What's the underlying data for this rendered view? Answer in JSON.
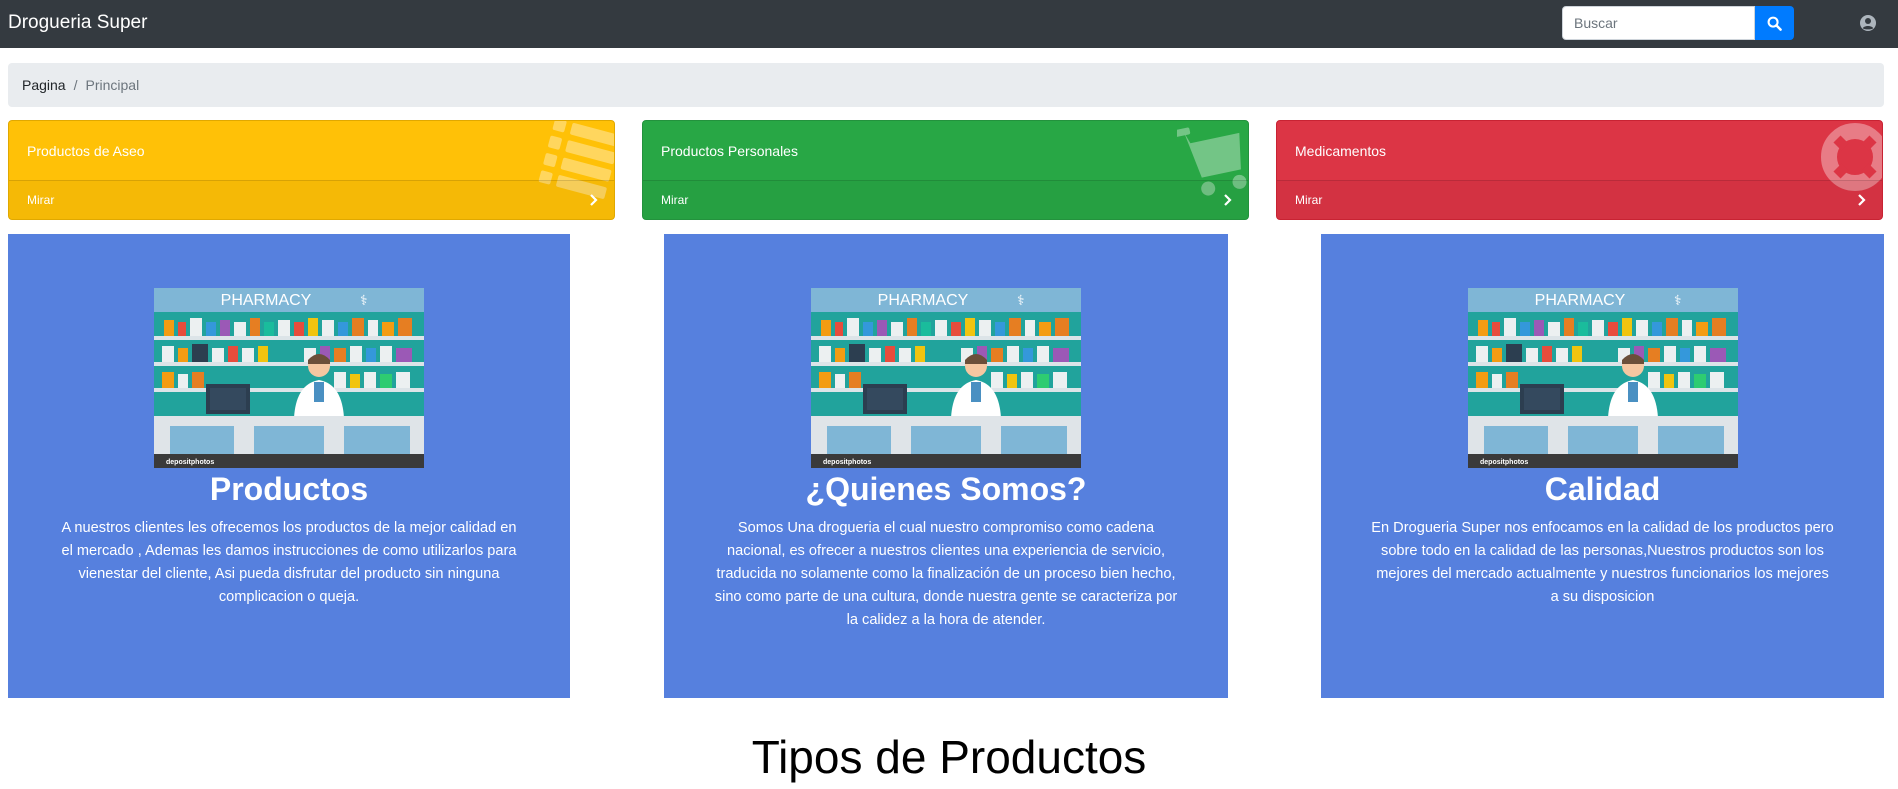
{
  "navbar": {
    "brand": "Drogueria Super",
    "search_placeholder": "Buscar",
    "search_icon": "search-icon",
    "user_icon": "user-circle-icon"
  },
  "breadcrumb": {
    "items": [
      "Pagina",
      "Principal"
    ],
    "separator": "/"
  },
  "categories": [
    {
      "title": "Productos de Aseo",
      "link": "Mirar",
      "color": "#ffc107",
      "icon": "list-icon"
    },
    {
      "title": "Productos Personales",
      "link": "Mirar",
      "color": "#28a745",
      "icon": "cart-icon"
    },
    {
      "title": "Medicamentos",
      "link": "Mirar",
      "color": "#dc3545",
      "icon": "life-ring-icon"
    }
  ],
  "panels": [
    {
      "title": "Productos",
      "text": "A nuestros clientes les ofrecemos los productos de la mejor calidad en el mercado , Ademas les damos instrucciones de como utilizarlos para vienestar del cliente, Asi pueda disfrutar del producto sin ninguna complicacion o queja.",
      "image_label": "PHARMACY",
      "watermark": "depositphotos"
    },
    {
      "title": "¿Quienes Somos?",
      "text": "Somos Una drogueria el cual nuestro compromiso como cadena nacional, es ofrecer a nuestros clientes una experiencia de servicio, traducida no solamente como la finalización de un proceso bien hecho, sino como parte de una cultura, donde nuestra gente se caracteriza por la calidez a la hora de atender.",
      "image_label": "PHARMACY",
      "watermark": "depositphotos"
    },
    {
      "title": "Calidad",
      "text": "En Drogueria Super nos enfocamos en la calidad de los productos pero sobre todo en la calidad de las personas,Nuestros productos son los mejores del mercado actualmente y nuestros funcionarios los mejores a su disposicion",
      "image_label": "PHARMACY",
      "watermark": "depositphotos"
    }
  ],
  "section_heading": "Tipos de Productos",
  "colors": {
    "navbar": "#343a40",
    "panel": "#5680de",
    "accent": "#007bff"
  }
}
